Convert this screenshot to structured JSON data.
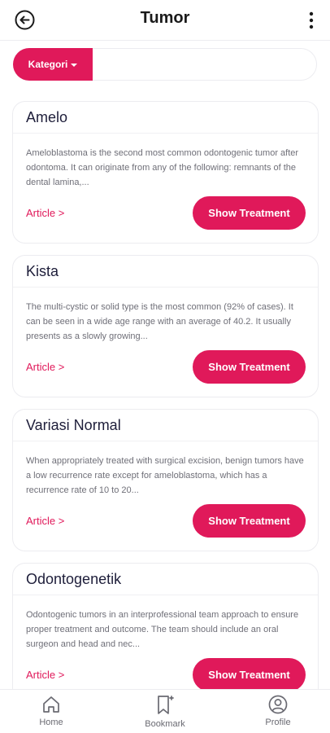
{
  "header": {
    "title": "Tumor",
    "back_icon": "arrow-left-circle-icon",
    "more_icon": "more-vertical-icon"
  },
  "filter": {
    "category_label": "Kategori",
    "category_icon": "chevron-down-icon"
  },
  "cards": [
    {
      "title": "Amelo",
      "description": "Ameloblastoma is the second most common odontogenic tumor after odontoma. It can originate from any of the following: remnants of the dental lamina,...",
      "article_label": "Article >",
      "button_label": "Show Treatment"
    },
    {
      "title": "Kista",
      "description": "The multi-cystic or solid type is the most common (92% of cases). It can be seen in a wide age range with an average of 40.2. It usually presents as a slowly growing...",
      "article_label": "Article >",
      "button_label": "Show Treatment"
    },
    {
      "title": "Variasi Normal",
      "description": "When appropriately treated with surgical excision, benign tumors have a low recurrence rate except for ameloblastoma, which has a recurrence rate of 10 to 20...",
      "article_label": "Article >",
      "button_label": "Show Treatment"
    },
    {
      "title": "Odontogenetik",
      "description": "Odontogenic tumors in an interprofessional team approach to ensure proper treatment and outcome. The team should include an oral surgeon and head and nec...",
      "article_label": "Article >",
      "button_label": "Show Treatment"
    }
  ],
  "bottom_nav": {
    "items": [
      {
        "label": "Home",
        "icon": "home-icon"
      },
      {
        "label": "Bookmark",
        "icon": "bookmark-icon"
      },
      {
        "label": "Profile",
        "icon": "profile-icon"
      }
    ]
  },
  "colors": {
    "accent": "#e0195a",
    "text_primary": "#1e1e3a",
    "text_secondary": "#6f6f78",
    "border": "#ececf0"
  }
}
